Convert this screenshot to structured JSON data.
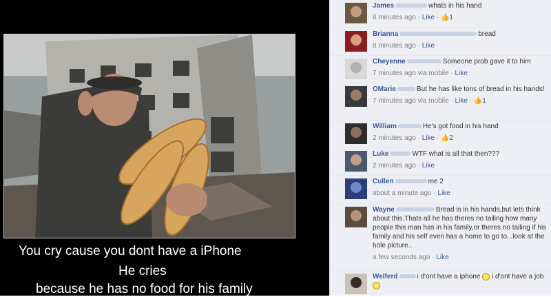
{
  "poster": {
    "caption_line1": "You cry cause you dont have a iPhone",
    "caption_line2": "He cries",
    "caption_line3": "because he has no food for his family"
  },
  "comments": [
    {
      "author": "James",
      "text": "whats in his hand",
      "time": "8 minutes ago",
      "via": "",
      "like_label": "Like",
      "likes": "1"
    },
    {
      "author": "Brianna",
      "text": "bread",
      "time": "8 minutes ago",
      "via": "",
      "like_label": "Like",
      "likes": ""
    },
    {
      "author": "Cheyenne",
      "text": "Someone prob gave it to him",
      "time": "7 minutes ago",
      "via": "via mobile",
      "like_label": "Like",
      "likes": ""
    },
    {
      "author": "OMarie",
      "text": "But he has like tons of bread in his hands!",
      "time": "7 minutes ago",
      "via": "via mobile",
      "like_label": "Like",
      "likes": "1"
    },
    {
      "author": "William",
      "text": "He's got food in his hand",
      "time": "2 minutes ago",
      "via": "",
      "like_label": "Like",
      "likes": "2"
    },
    {
      "author": "Luke",
      "text": "WTF what is all that then???",
      "time": "2 minutes ago",
      "via": "",
      "like_label": "Like",
      "likes": ""
    },
    {
      "author": "Cullen",
      "text": "me 2",
      "time": "about a minute ago",
      "via": "",
      "like_label": "Like",
      "likes": ""
    },
    {
      "author": "Wayne",
      "text": "Bread is in his hands,but lets think about this.Thats all he has theres no tailing how many people this man has in his family,or theres no tailing if his family and his self even has a home to go to...look at the hole picture..",
      "time": "a few seconds ago",
      "via": "",
      "like_label": "Like",
      "likes": ""
    },
    {
      "author": "Welferd",
      "text": "i d'ont have a iphone",
      "text2": "i d'ont have a job",
      "time": "",
      "via": "",
      "like_label": "",
      "likes": ""
    }
  ],
  "colors": {
    "link": "#3b5998",
    "comment_bg": "#edeff4",
    "poster_bg": "#000000"
  },
  "icons": [
    "thumbs-up-icon",
    "smiley-icon"
  ]
}
